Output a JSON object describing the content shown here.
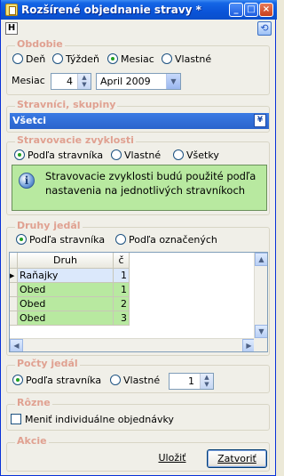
{
  "window": {
    "title": "Rozšírené objednanie stravy *"
  },
  "obdobie": {
    "label": "Obdobie",
    "options": [
      "Deň",
      "Týždeň",
      "Mesiac",
      "Vlastné"
    ],
    "selected": "Mesiac",
    "mesiac_label": "Mesiac",
    "month_number": "4",
    "month_select": "April 2009"
  },
  "stravnici": {
    "label": "Stravníci, skupiny",
    "value": "Všetci"
  },
  "zvyklosti": {
    "label": "Stravovacie zvyklosti",
    "options": [
      "Podľa stravníka",
      "Vlastné",
      "Všetky"
    ],
    "selected": "Podľa stravníka",
    "info_line1": "Stravovacie zvyklosti budú použité podľa",
    "info_line2": "nastavenia na jednotlivých stravníkoch"
  },
  "druhy": {
    "label": "Druhy jedál",
    "options": [
      "Podľa stravníka",
      "Podľa označených"
    ],
    "selected": "Podľa stravníka",
    "columns": [
      "Druh",
      "č"
    ],
    "rows": [
      {
        "druh": "Raňajky",
        "c": "1"
      },
      {
        "druh": "Obed",
        "c": "1"
      },
      {
        "druh": "Obed",
        "c": "2"
      },
      {
        "druh": "Obed",
        "c": "3"
      }
    ]
  },
  "pocty": {
    "label": "Počty jedál",
    "options": [
      "Podľa stravníka",
      "Vlastné"
    ],
    "selected": "Podľa stravníka",
    "value": "1"
  },
  "rozne": {
    "label": "Rôzne",
    "checkbox_label": "Meniť individuálne objednávky",
    "checked": false
  },
  "akcie": {
    "label": "Akcie",
    "save_label": "Uložiť",
    "close_label": "Zatvoriť"
  },
  "colors": {
    "group_label": "#e0a191",
    "info_background": "#b8e9a0",
    "row_blue": "#dbe8fb",
    "row_green": "#b8e9a0",
    "selection_bar": "#2a63cc"
  }
}
